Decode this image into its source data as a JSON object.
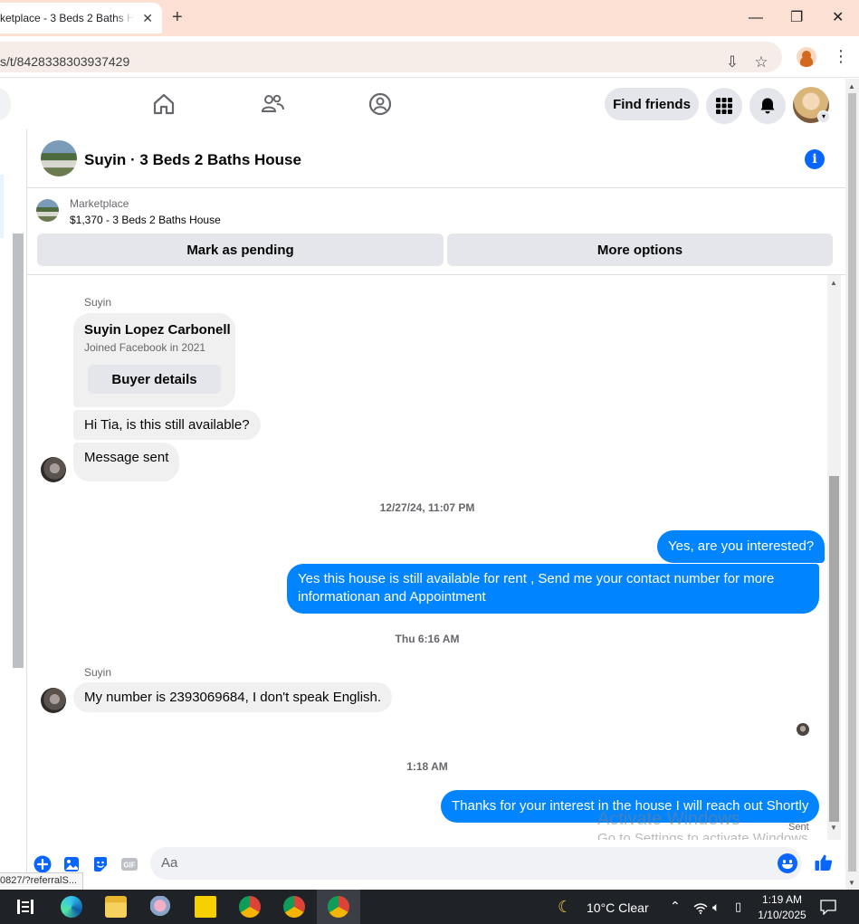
{
  "browser": {
    "tab_title": "ketplace - 3 Beds 2 Baths H",
    "url": "s/t/8428338303937429",
    "status_url": "0827/?referralS..."
  },
  "nav": {
    "find_friends": "Find friends"
  },
  "conversation": {
    "title": "Suyin · 3 Beds 2 Baths House",
    "marketplace_label": "Marketplace",
    "listing": "$1,370 - 3 Beds 2 Baths House",
    "mark_pending": "Mark as pending",
    "more_options": "More options"
  },
  "messages": {
    "sender_1": "Suyin",
    "card_name": "Suyin Lopez Carbonell",
    "card_sub": "Joined Facebook in 2021",
    "card_button": "Buyer details",
    "in_1": "Hi Tia, is this still available?",
    "in_2": "Message sent",
    "stamp_1": "12/27/24, 11:07 PM",
    "out_1": "Yes, are you interested?",
    "out_2": "Yes this house is still available for rent , Send me your contact number for more informationan and Appointment",
    "stamp_2": "Thu 6:16 AM",
    "sender_2": "Suyin",
    "in_3": "My number is 2393069684, I don't speak English.",
    "stamp_3": "1:18 AM",
    "out_3": "Thanks for your interest in the house I will reach out Shortly",
    "sent_label": "Sent"
  },
  "composer": {
    "placeholder": "Aa"
  },
  "watermark": {
    "line1": "Activate Windows",
    "line2": "Go to Settings to activate Windows."
  },
  "taskbar": {
    "weather": "10°C  Clear",
    "time": "1:19 AM",
    "date": "1/10/2025"
  },
  "colors": {
    "messenger_blue": "#0084ff",
    "fb_blue": "#0866ff",
    "tabstrip": "#fbe0d3"
  }
}
